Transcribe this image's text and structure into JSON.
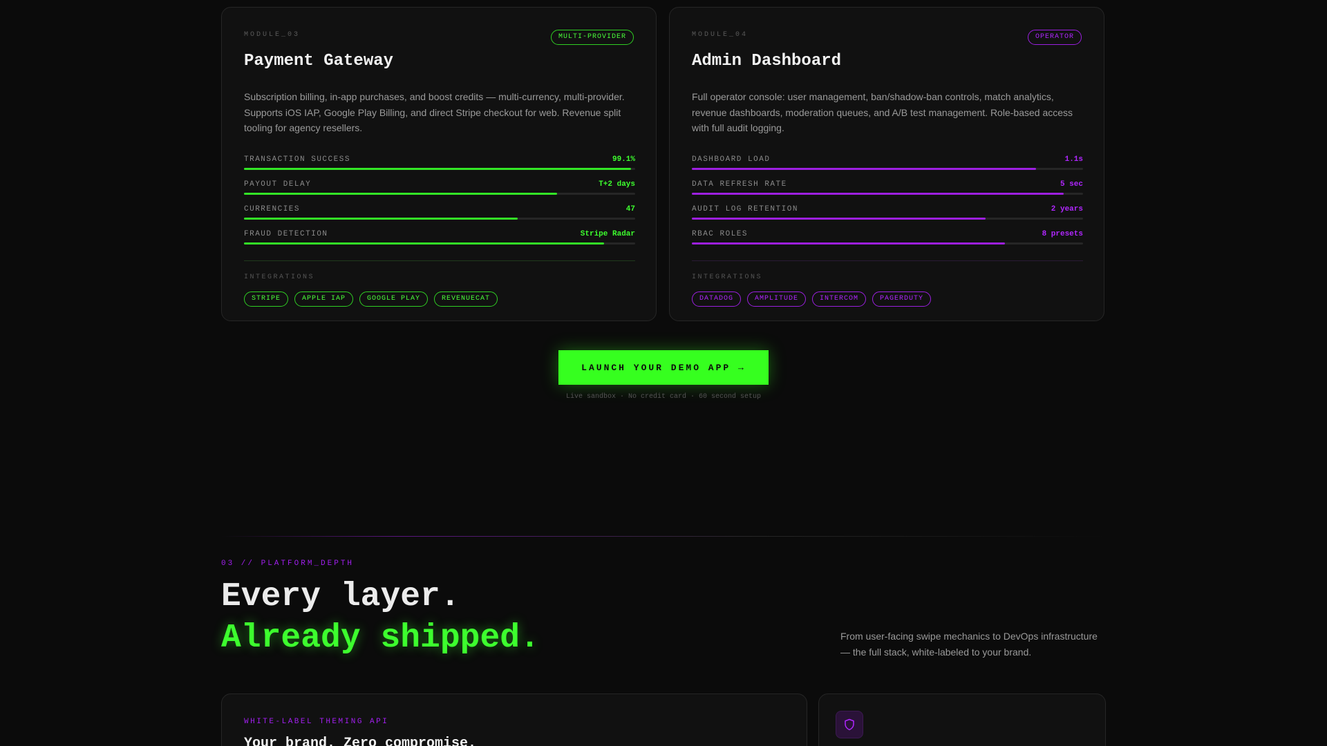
{
  "cards": [
    {
      "tag": "MODULE_03",
      "badge": "MULTI-PROVIDER",
      "title": "Payment Gateway",
      "description": "Subscription billing, in-app purchases, and boost credits — multi-currency, multi-provider. Supports iOS IAP, Google Play Billing, and direct Stripe checkout for web. Revenue split tooling for agency resellers.",
      "accent": "#3dff2e",
      "metrics": [
        {
          "label": "TRANSACTION SUCCESS",
          "value": "99.1%",
          "level": 0.99
        },
        {
          "label": "PAYOUT DELAY",
          "value": "T+2 days",
          "level": 0.8
        },
        {
          "label": "CURRENCIES",
          "value": "47",
          "level": 0.7
        },
        {
          "label": "FRAUD DETECTION",
          "value": "Stripe Radar",
          "level": 0.92
        }
      ],
      "integrations_label": "INTEGRATIONS",
      "integrations": [
        "STRIPE",
        "APPLE IAP",
        "GOOGLE PLAY",
        "REVENUECAT"
      ]
    },
    {
      "tag": "MODULE_04",
      "badge": "OPERATOR",
      "title": "Admin Dashboard",
      "description": "Full operator console: user management, ban/shadow-ban controls, match analytics, revenue dashboards, moderation queues, and A/B test management. Role-based access with full audit logging.",
      "accent": "#b026ff",
      "metrics": [
        {
          "label": "DASHBOARD LOAD",
          "value": "1.1s",
          "level": 0.88
        },
        {
          "label": "DATA REFRESH RATE",
          "value": "5 sec",
          "level": 0.95
        },
        {
          "label": "AUDIT LOG RETENTION",
          "value": "2 years",
          "level": 0.75
        },
        {
          "label": "RBAC ROLES",
          "value": "8 presets",
          "level": 0.8
        }
      ],
      "integrations_label": "INTEGRATIONS",
      "integrations": [
        "DATADOG",
        "AMPLITUDE",
        "INTERCOM",
        "PAGERDUTY"
      ]
    }
  ],
  "cta": {
    "label": "LAUNCH YOUR DEMO APP →",
    "note": "Live sandbox · No credit card · 60 second setup"
  },
  "section": {
    "tag": "03 // PLATFORM_DEPTH",
    "headline_line1": "Every layer.",
    "headline_line2": "Already shipped.",
    "description": "From user-facing swipe mechanics to DevOps infrastructure — the full stack, white-labeled to your brand."
  },
  "feature_cards": {
    "left": {
      "tag": "WHITE-LABEL THEMING API",
      "title": "Your brand. Zero compromise."
    },
    "right": {
      "icon": "shield-icon"
    }
  }
}
